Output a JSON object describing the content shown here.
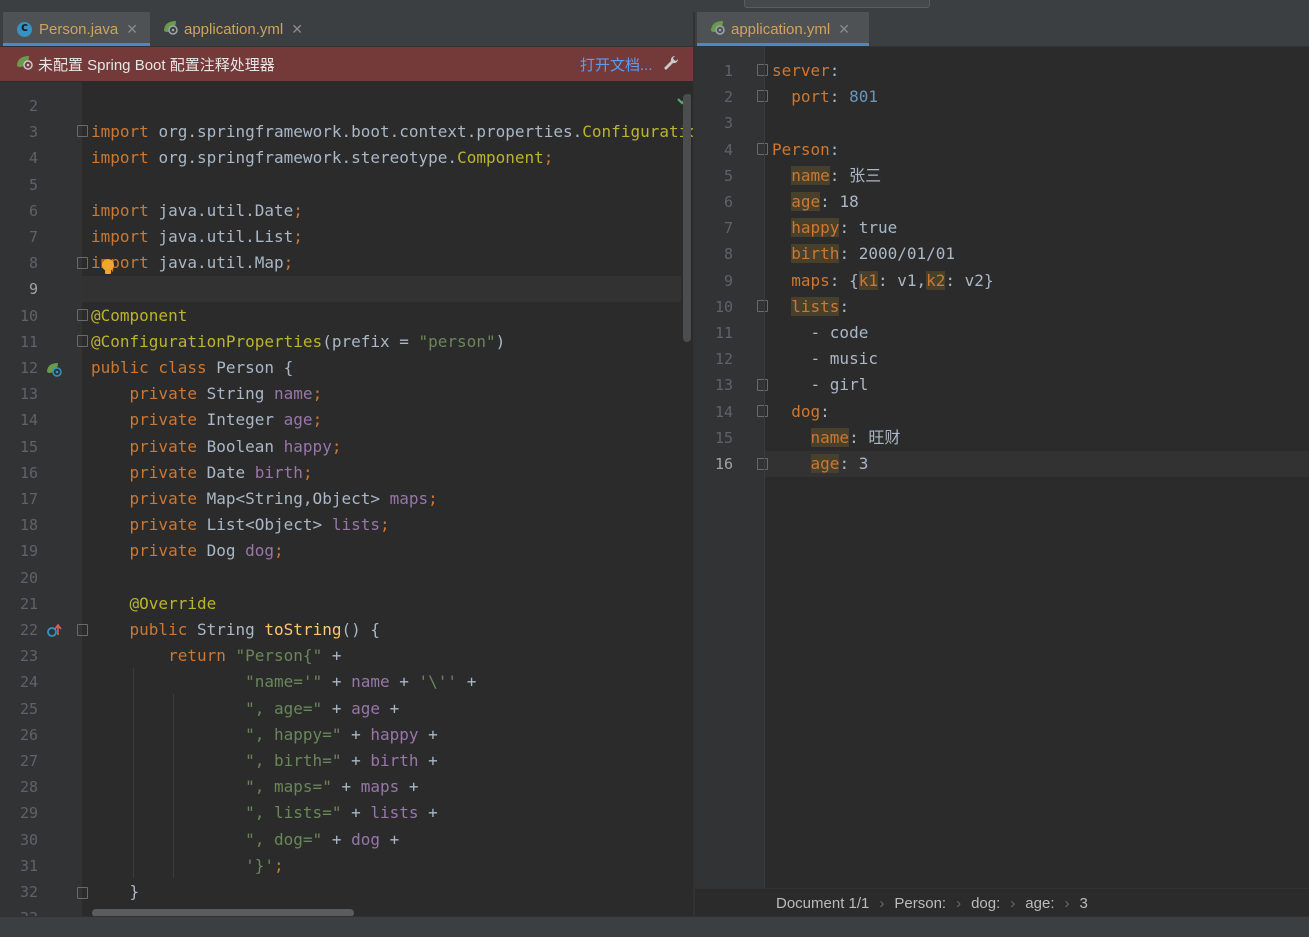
{
  "left_tabs": [
    {
      "label": "Person.java",
      "icon": "java-class-icon",
      "active": true
    },
    {
      "label": "application.yml",
      "icon": "spring-leaf-icon",
      "active": false
    }
  ],
  "right_tabs": [
    {
      "label": "application.yml",
      "icon": "spring-leaf-icon",
      "active": true
    }
  ],
  "banner": {
    "message": "未配置 Spring Boot 配置注释处理器",
    "link": "打开文档..."
  },
  "java": {
    "current_line": 9,
    "lines": [
      {
        "n": 2,
        "t": []
      },
      {
        "n": 3,
        "t": [
          [
            "k",
            "import "
          ],
          [
            "p",
            "org.springframework.boot.context.properties."
          ],
          [
            "a",
            "ConfigurationProperties"
          ]
        ]
      },
      {
        "n": 4,
        "t": [
          [
            "k",
            "import "
          ],
          [
            "p",
            "org.springframework.stereotype."
          ],
          [
            "a",
            "Component"
          ],
          [
            "k",
            ";"
          ]
        ]
      },
      {
        "n": 5,
        "t": []
      },
      {
        "n": 6,
        "t": [
          [
            "k",
            "import "
          ],
          [
            "p",
            "java.util.Date"
          ],
          [
            "k",
            ";"
          ]
        ]
      },
      {
        "n": 7,
        "t": [
          [
            "k",
            "import "
          ],
          [
            "p",
            "java.util.List"
          ],
          [
            "k",
            ";"
          ]
        ]
      },
      {
        "n": 8,
        "t": [
          [
            "k",
            "import "
          ],
          [
            "p",
            "java.util.Map"
          ],
          [
            "k",
            ";"
          ]
        ]
      },
      {
        "n": 9,
        "t": []
      },
      {
        "n": 10,
        "t": [
          [
            "a",
            "@Component"
          ]
        ]
      },
      {
        "n": 11,
        "t": [
          [
            "a",
            "@ConfigurationProperties"
          ],
          [
            "p",
            "(prefix = "
          ],
          [
            "s",
            "\"person\""
          ],
          [
            "p",
            ")"
          ]
        ]
      },
      {
        "n": 12,
        "t": [
          [
            "k",
            "public class "
          ],
          [
            "p",
            "Person {"
          ]
        ]
      },
      {
        "n": 13,
        "t": [
          [
            "p",
            "    "
          ],
          [
            "k",
            "private "
          ],
          [
            "p",
            "String "
          ],
          [
            "f",
            "name"
          ],
          [
            "k",
            ";"
          ]
        ]
      },
      {
        "n": 14,
        "t": [
          [
            "p",
            "    "
          ],
          [
            "k",
            "private "
          ],
          [
            "p",
            "Integer "
          ],
          [
            "f",
            "age"
          ],
          [
            "k",
            ";"
          ]
        ]
      },
      {
        "n": 15,
        "t": [
          [
            "p",
            "    "
          ],
          [
            "k",
            "private "
          ],
          [
            "p",
            "Boolean "
          ],
          [
            "f",
            "happy"
          ],
          [
            "k",
            ";"
          ]
        ]
      },
      {
        "n": 16,
        "t": [
          [
            "p",
            "    "
          ],
          [
            "k",
            "private "
          ],
          [
            "p",
            "Date "
          ],
          [
            "f",
            "birth"
          ],
          [
            "k",
            ";"
          ]
        ]
      },
      {
        "n": 17,
        "t": [
          [
            "p",
            "    "
          ],
          [
            "k",
            "private "
          ],
          [
            "p",
            "Map<String,Object> "
          ],
          [
            "f",
            "maps"
          ],
          [
            "k",
            ";"
          ]
        ]
      },
      {
        "n": 18,
        "t": [
          [
            "p",
            "    "
          ],
          [
            "k",
            "private "
          ],
          [
            "p",
            "List<Object> "
          ],
          [
            "f",
            "lists"
          ],
          [
            "k",
            ";"
          ]
        ]
      },
      {
        "n": 19,
        "t": [
          [
            "p",
            "    "
          ],
          [
            "k",
            "private "
          ],
          [
            "p",
            "Dog "
          ],
          [
            "f",
            "dog"
          ],
          [
            "k",
            ";"
          ]
        ]
      },
      {
        "n": 20,
        "t": []
      },
      {
        "n": 21,
        "t": [
          [
            "p",
            "    "
          ],
          [
            "a",
            "@Override"
          ]
        ]
      },
      {
        "n": 22,
        "t": [
          [
            "p",
            "    "
          ],
          [
            "k",
            "public "
          ],
          [
            "p",
            "String "
          ],
          [
            "m",
            "toString"
          ],
          [
            "p",
            "() {"
          ]
        ]
      },
      {
        "n": 23,
        "t": [
          [
            "p",
            "        "
          ],
          [
            "k",
            "return "
          ],
          [
            "s",
            "\"Person{\""
          ],
          [
            "p",
            " +"
          ]
        ]
      },
      {
        "n": 24,
        "t": [
          [
            "p",
            "                "
          ],
          [
            "s",
            "\"name='\""
          ],
          [
            "p",
            " + "
          ],
          [
            "f",
            "name"
          ],
          [
            "p",
            " + "
          ],
          [
            "s",
            "'\\''"
          ],
          [
            "p",
            " +"
          ]
        ]
      },
      {
        "n": 25,
        "t": [
          [
            "p",
            "                "
          ],
          [
            "s",
            "\", age=\""
          ],
          [
            "p",
            " + "
          ],
          [
            "f",
            "age"
          ],
          [
            "p",
            " +"
          ]
        ]
      },
      {
        "n": 26,
        "t": [
          [
            "p",
            "                "
          ],
          [
            "s",
            "\", happy=\""
          ],
          [
            "p",
            " + "
          ],
          [
            "f",
            "happy"
          ],
          [
            "p",
            " +"
          ]
        ]
      },
      {
        "n": 27,
        "t": [
          [
            "p",
            "                "
          ],
          [
            "s",
            "\", birth=\""
          ],
          [
            "p",
            " + "
          ],
          [
            "f",
            "birth"
          ],
          [
            "p",
            " +"
          ]
        ]
      },
      {
        "n": 28,
        "t": [
          [
            "p",
            "                "
          ],
          [
            "s",
            "\", maps=\""
          ],
          [
            "p",
            " + "
          ],
          [
            "f",
            "maps"
          ],
          [
            "p",
            " +"
          ]
        ]
      },
      {
        "n": 29,
        "t": [
          [
            "p",
            "                "
          ],
          [
            "s",
            "\", lists=\""
          ],
          [
            "p",
            " + "
          ],
          [
            "f",
            "lists"
          ],
          [
            "p",
            " +"
          ]
        ]
      },
      {
        "n": 30,
        "t": [
          [
            "p",
            "                "
          ],
          [
            "s",
            "\", dog=\""
          ],
          [
            "p",
            " + "
          ],
          [
            "f",
            "dog"
          ],
          [
            "p",
            " +"
          ]
        ]
      },
      {
        "n": 31,
        "t": [
          [
            "p",
            "                "
          ],
          [
            "s",
            "'}'"
          ],
          [
            "k",
            ";"
          ]
        ]
      },
      {
        "n": 32,
        "t": [
          [
            "p",
            "    }"
          ]
        ]
      },
      {
        "n": 33,
        "t": []
      }
    ]
  },
  "yaml": {
    "current_line": 16,
    "lines": [
      {
        "n": 1,
        "t": [
          [
            "yk",
            "server"
          ],
          [
            "p",
            ":"
          ]
        ]
      },
      {
        "n": 2,
        "t": [
          [
            "p",
            "  "
          ],
          [
            "yk",
            "port"
          ],
          [
            "p",
            ": "
          ],
          [
            "n",
            "801"
          ]
        ]
      },
      {
        "n": 3,
        "t": []
      },
      {
        "n": 4,
        "t": [
          [
            "yk",
            "Person"
          ],
          [
            "p",
            ":"
          ]
        ]
      },
      {
        "n": 5,
        "t": [
          [
            "p",
            "  "
          ],
          [
            "hk",
            "name"
          ],
          [
            "p",
            ": 张三"
          ]
        ]
      },
      {
        "n": 6,
        "t": [
          [
            "p",
            "  "
          ],
          [
            "hk",
            "age"
          ],
          [
            "p",
            ": 18"
          ]
        ]
      },
      {
        "n": 7,
        "t": [
          [
            "p",
            "  "
          ],
          [
            "hk",
            "happy"
          ],
          [
            "p",
            ": true"
          ]
        ]
      },
      {
        "n": 8,
        "t": [
          [
            "p",
            "  "
          ],
          [
            "hk",
            "birth"
          ],
          [
            "p",
            ": 2000/01/01"
          ]
        ]
      },
      {
        "n": 9,
        "t": [
          [
            "p",
            "  "
          ],
          [
            "yk",
            "maps"
          ],
          [
            "p",
            ": {"
          ],
          [
            "hk",
            "k1"
          ],
          [
            "p",
            ": v1,"
          ],
          [
            "hk",
            "k2"
          ],
          [
            "p",
            ": v2}"
          ]
        ]
      },
      {
        "n": 10,
        "t": [
          [
            "p",
            "  "
          ],
          [
            "hk",
            "lists"
          ],
          [
            "p",
            ":"
          ]
        ]
      },
      {
        "n": 11,
        "t": [
          [
            "p",
            "    - code"
          ]
        ]
      },
      {
        "n": 12,
        "t": [
          [
            "p",
            "    - music"
          ]
        ]
      },
      {
        "n": 13,
        "t": [
          [
            "p",
            "    - girl"
          ]
        ]
      },
      {
        "n": 14,
        "t": [
          [
            "p",
            "  "
          ],
          [
            "yk",
            "dog"
          ],
          [
            "p",
            ":"
          ]
        ]
      },
      {
        "n": 15,
        "t": [
          [
            "p",
            "    "
          ],
          [
            "hk",
            "name"
          ],
          [
            "p",
            ": 旺财"
          ]
        ]
      },
      {
        "n": 16,
        "t": [
          [
            "p",
            "    "
          ],
          [
            "hk",
            "age"
          ],
          [
            "p",
            ": 3"
          ]
        ]
      }
    ]
  },
  "breadcrumb": [
    "Document 1/1",
    "Person:",
    "dog:",
    "age:",
    "3"
  ]
}
